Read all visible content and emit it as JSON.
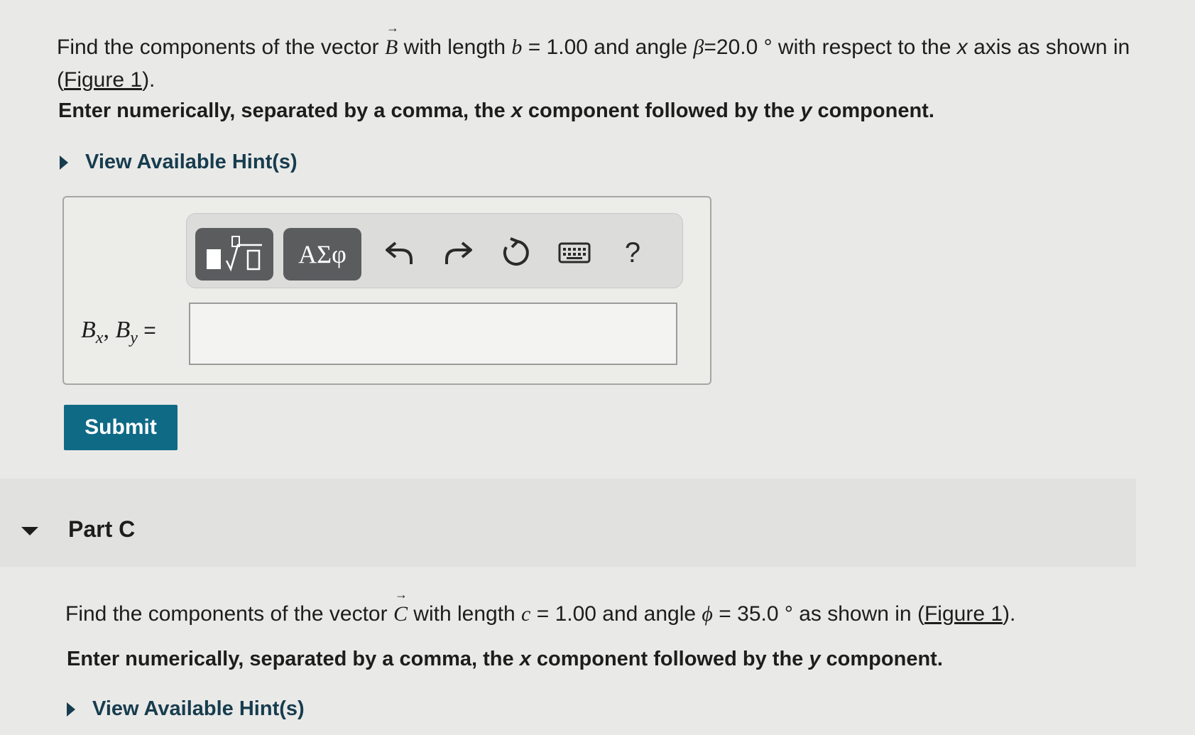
{
  "part_b": {
    "q_prefix": "Find the components of the vector ",
    "vector": "B",
    "q_mid1": " with length ",
    "len_var": "b",
    "q_mid2": " = 1.00 and angle ",
    "angle_var": "β",
    "q_mid3": "=20.0 ° with respect to the ",
    "axis_var": "x",
    "q_mid4": " axis as shown in ",
    "figure_open": "(",
    "figure_link": "Figure 1",
    "figure_close": ").",
    "instr_prefix": "Enter numerically, separated by a comma, the ",
    "instr_x": "x",
    "instr_mid": " component followed by the ",
    "instr_y": "y",
    "instr_suffix": " component.",
    "hint_label": "View Available Hint(s)",
    "answer_label_b1": "B",
    "answer_label_sub1": "x",
    "answer_label_sep": ", ",
    "answer_label_b2": "B",
    "answer_label_sub2": "y",
    "answer_label_eq": " =",
    "answer_value": "",
    "submit_label": "Submit"
  },
  "toolbar": {
    "greek_label": "ΑΣφ",
    "help_label": "?"
  },
  "part_c": {
    "title": "Part C",
    "q_prefix": "Find the components of the vector ",
    "vector": "C",
    "q_mid1": " with length ",
    "len_var": "c",
    "q_mid2": " = 1.00 and angle ",
    "angle_var": "ϕ",
    "q_mid3": " = 35.0 ° as shown in ",
    "figure_open": "(",
    "figure_link": "Figure 1",
    "figure_close": ").",
    "instr_prefix": "Enter numerically, separated by a comma, the ",
    "instr_x": "x",
    "instr_mid": " component followed by the ",
    "instr_y": "y",
    "instr_suffix": " component.",
    "hint_label": "View Available Hint(s)"
  }
}
